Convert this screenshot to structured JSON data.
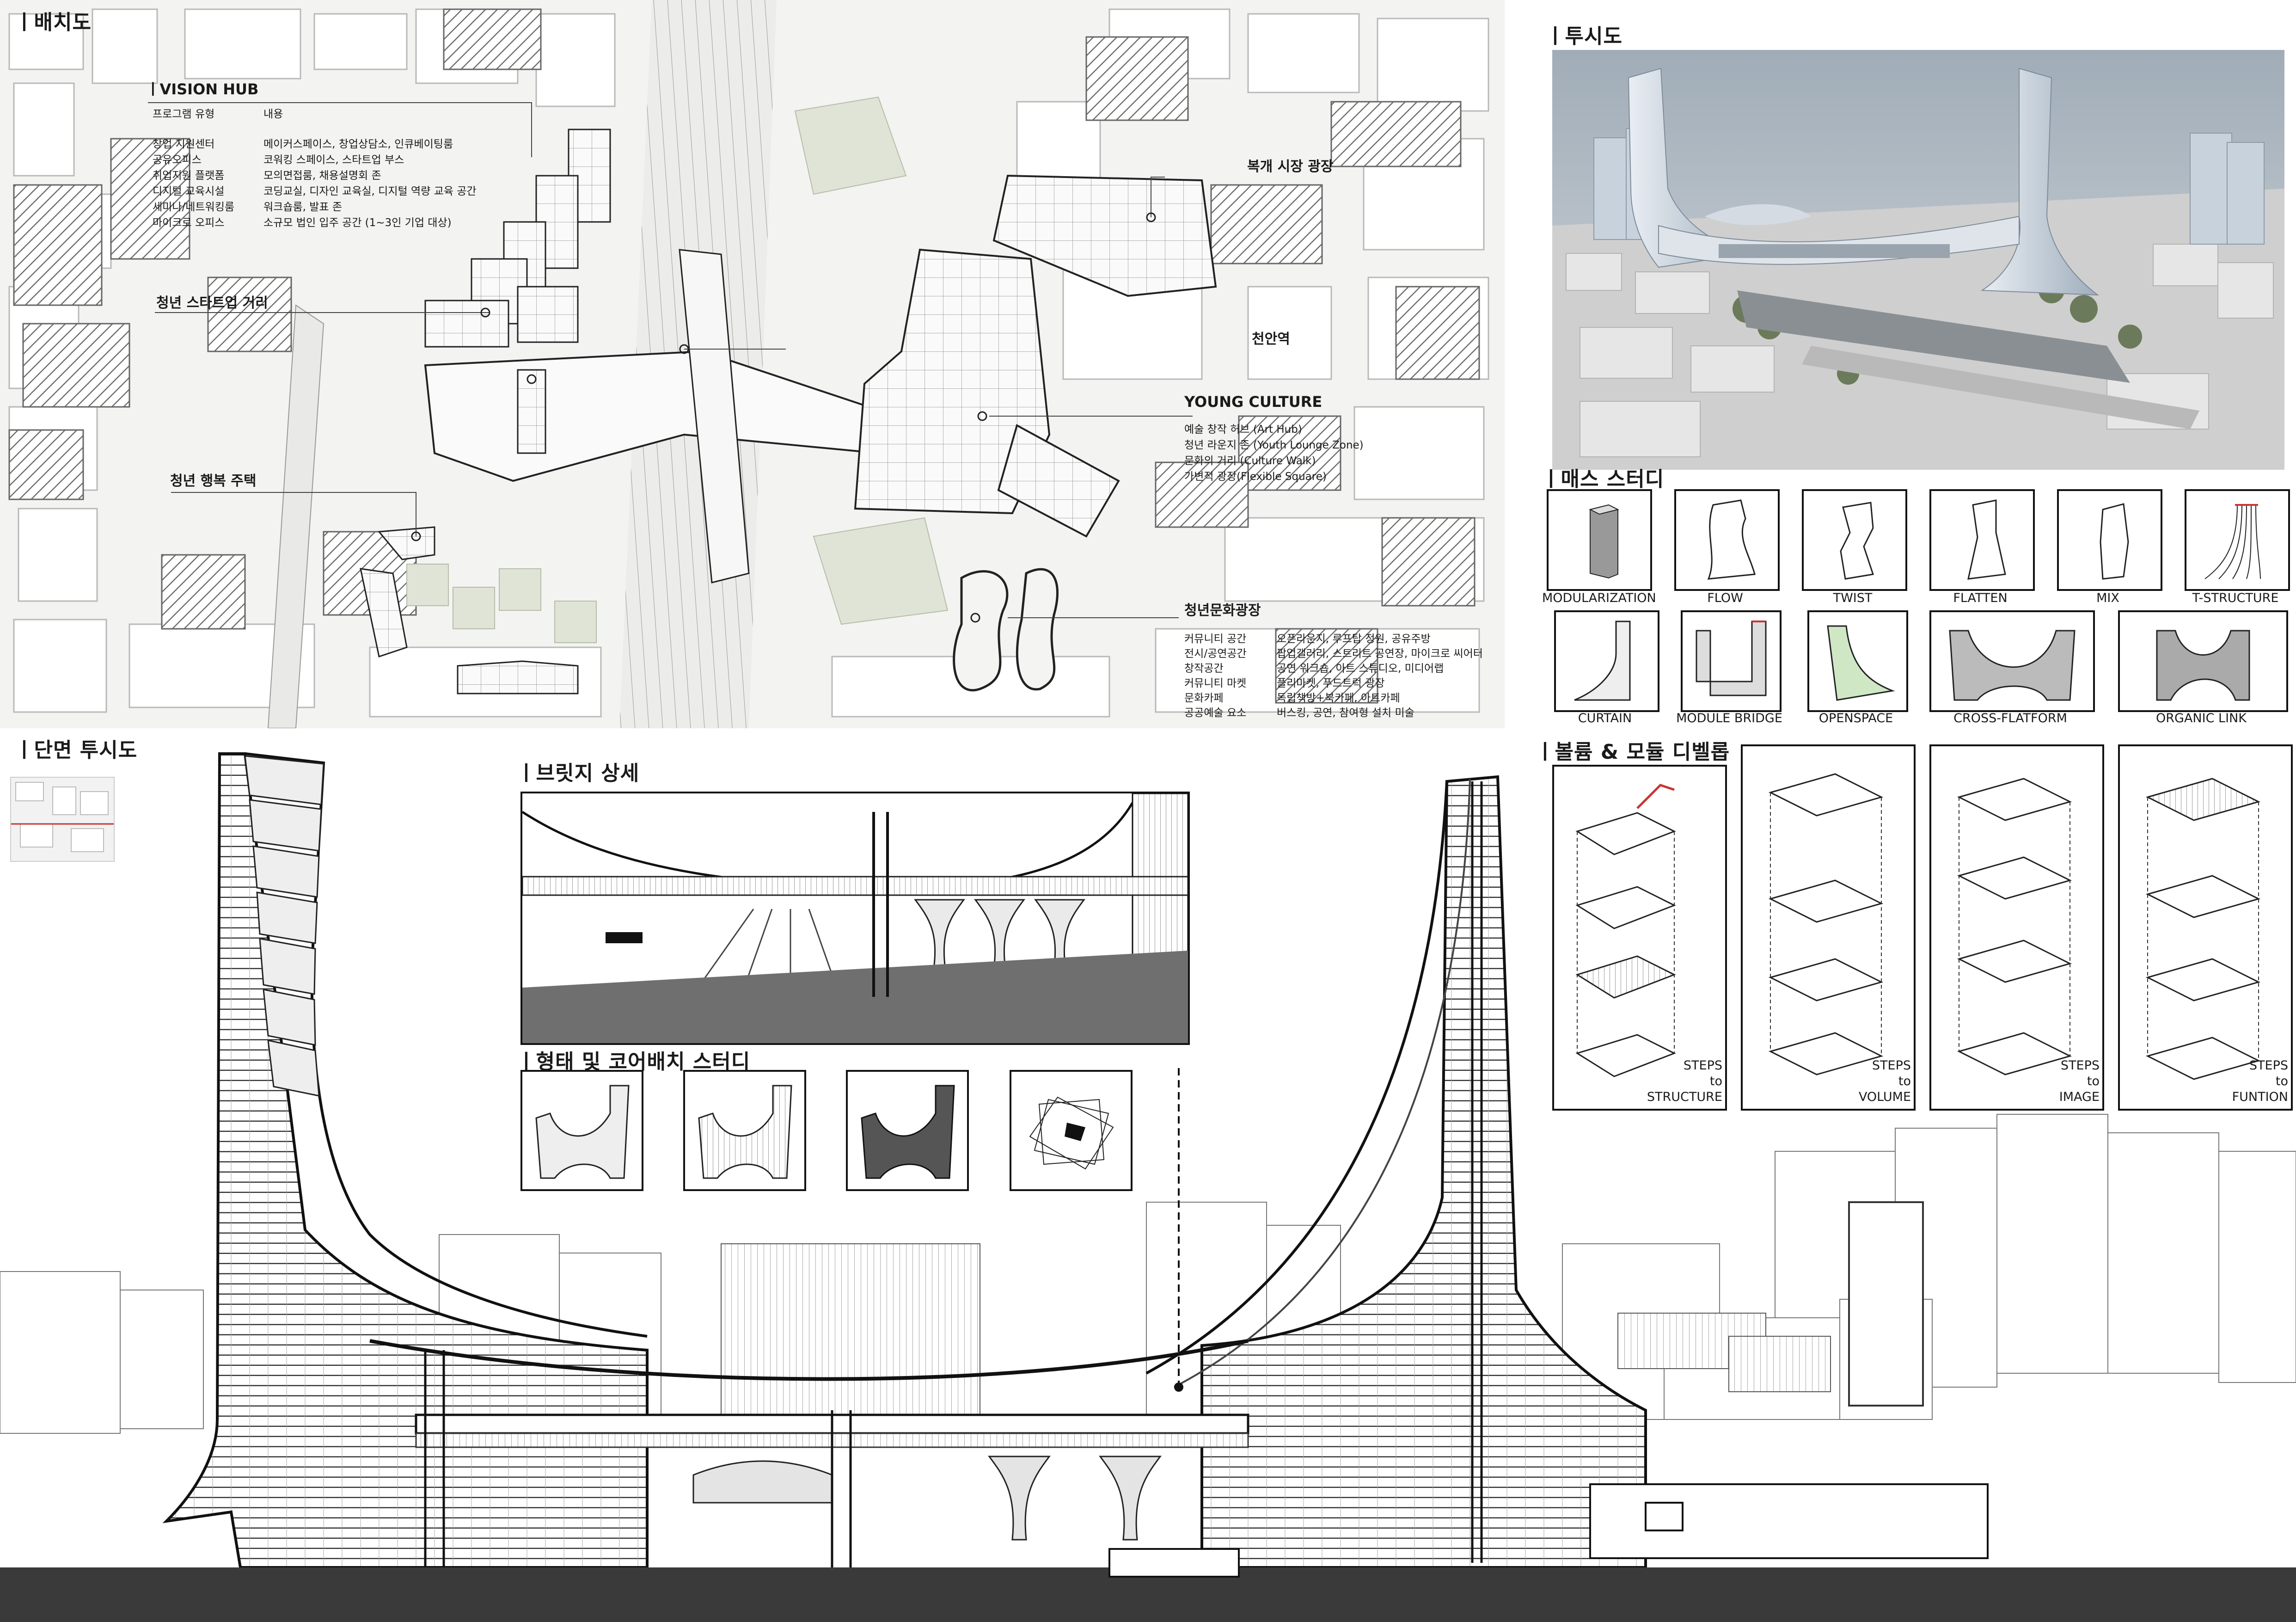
{
  "sections": {
    "site_plan": "ㅣ배치도",
    "perspective": "ㅣ투시도",
    "mass_study": "ㅣ매스 스터디",
    "section_perspective": "ㅣ단면 투시도",
    "bridge_detail": "ㅣ브릿지 상세",
    "form_core_study": "ㅣ형태 및 코어배치 스터디",
    "volume_module": "ㅣ볼륨 & 모듈 디벨롭"
  },
  "vision_hub": {
    "title": "ㅣVISION HUB",
    "header_col1": "프로그램 유형",
    "header_col2": "내용",
    "rows": [
      [
        "창업 지원센터",
        "메이커스페이스, 창업상담소, 인큐베이팅룸"
      ],
      [
        "공유오피스",
        "코워킹 스페이스, 스타트업 부스"
      ],
      [
        "취업지원 플랫폼",
        "모의면접룸, 채용설명회 존"
      ],
      [
        "디지털 교육시설",
        "코딩교실, 디자인 교육실, 디지털 역량 교육 공간"
      ],
      [
        "세미나/네트워킹룸",
        "워크숍룸, 발표 존"
      ],
      [
        "마이크로 오피스",
        "소규모 법인 입주 공간 (1~3인 기업 대상)"
      ]
    ]
  },
  "site_labels": {
    "startup_street": "청년 스타트업 거리",
    "happy_housing": "청년 행복 주택",
    "market_plaza": "복개 시장 광장",
    "station": "천안역"
  },
  "young_culture": {
    "title": "YOUNG CULTURE",
    "items": [
      "예술 창작 허브 (Art Hub)",
      "청년 라운지 존 (Youth Lounge Zone)",
      "문화의 거리 (Culture Walk)",
      "가변적 광장(Flexible Square)"
    ]
  },
  "culture_plaza": {
    "title": "청년문화광장",
    "rows": [
      [
        "커뮤니티 공간",
        "오픈라운지, 루프탑 정원, 공유주방"
      ],
      [
        "전시/공연공간",
        "팝업갤러리, 스트리트 공연장, 마이크로 씨어터"
      ],
      [
        "창작공간",
        "공연 워크숍, 아트 스튜디오, 미디어랩"
      ],
      [
        "커뮤니티 마켓",
        "플리마켓, 푸드트럭 광장"
      ],
      [
        "문화카페",
        "독립책방+북카페, 아트카페"
      ],
      [
        "공공예술 요소",
        "버스킹, 공연, 참여형 설치 미술"
      ]
    ]
  },
  "mass_study": {
    "row1": [
      "MODULARIZATION",
      "FLOW",
      "TWIST",
      "FLATTEN",
      "MIX",
      "T-STRUCTURE"
    ],
    "row2": [
      "CURTAIN",
      "MODULE BRIDGE",
      "OPENSPACE",
      "CROSS-FLATFORM",
      "ORGANIC LINK"
    ]
  },
  "volume_steps": [
    [
      "STEPS",
      "to",
      "STRUCTURE"
    ],
    [
      "STEPS",
      "to",
      "VOLUME"
    ],
    [
      "STEPS",
      "to",
      "IMAGE"
    ],
    [
      "STEPS",
      "to",
      "FUNTION"
    ]
  ],
  "colors": {
    "ink": "#111111",
    "hatch": "#777777",
    "green": "#dfe4d6",
    "ground": "#3a3a3a",
    "sky": "#a7b3be"
  }
}
